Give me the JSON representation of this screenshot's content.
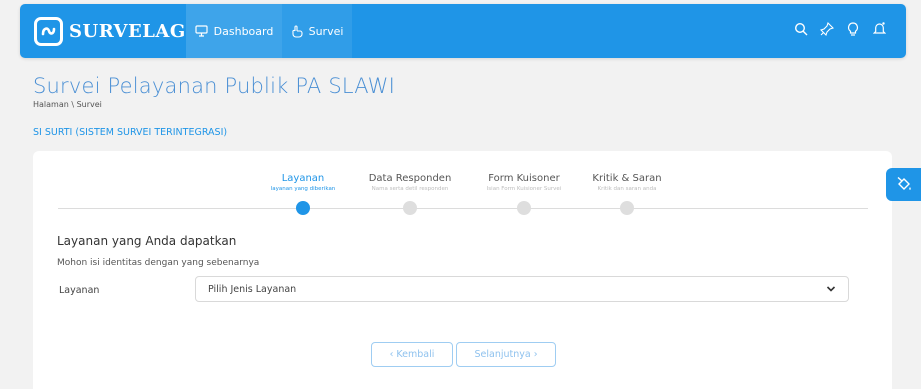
{
  "navbar": {
    "brand": "SURVELAG",
    "items": [
      {
        "label": "Dashboard",
        "icon": "monitor-icon"
      },
      {
        "label": "Survei",
        "icon": "hand-pointer-icon"
      }
    ],
    "icons": [
      "search-icon",
      "pin-icon",
      "bulb-icon",
      "bell-icon"
    ],
    "accent_color": "#1f95e7"
  },
  "page": {
    "title": "Survei Pelayanan Publik PA SLAWI",
    "breadcrumb": "Halaman \\ Survei",
    "section_label": "SI SURTI (SISTEM SURVEI TERINTEGRASI)"
  },
  "steps": [
    {
      "title": "Layanan",
      "subtitle": "layanan yang diberikan",
      "active": true
    },
    {
      "title": "Data Responden",
      "subtitle": "Nama serta detil responden",
      "active": false
    },
    {
      "title": "Form Kuisoner",
      "subtitle": "Isian Form Kuisioner Survei",
      "active": false
    },
    {
      "title": "Kritik & Saran",
      "subtitle": "Kritik dan saran anda",
      "active": false
    }
  ],
  "form": {
    "heading": "Layanan yang Anda dapatkan",
    "note": "Mohon isi identitas dengan yang sebenarnya",
    "field_label": "Layanan",
    "select_value": "Pilih Jenis Layanan"
  },
  "buttons": {
    "back": "‹ Kembali",
    "next": "Selanjutnya ›"
  }
}
